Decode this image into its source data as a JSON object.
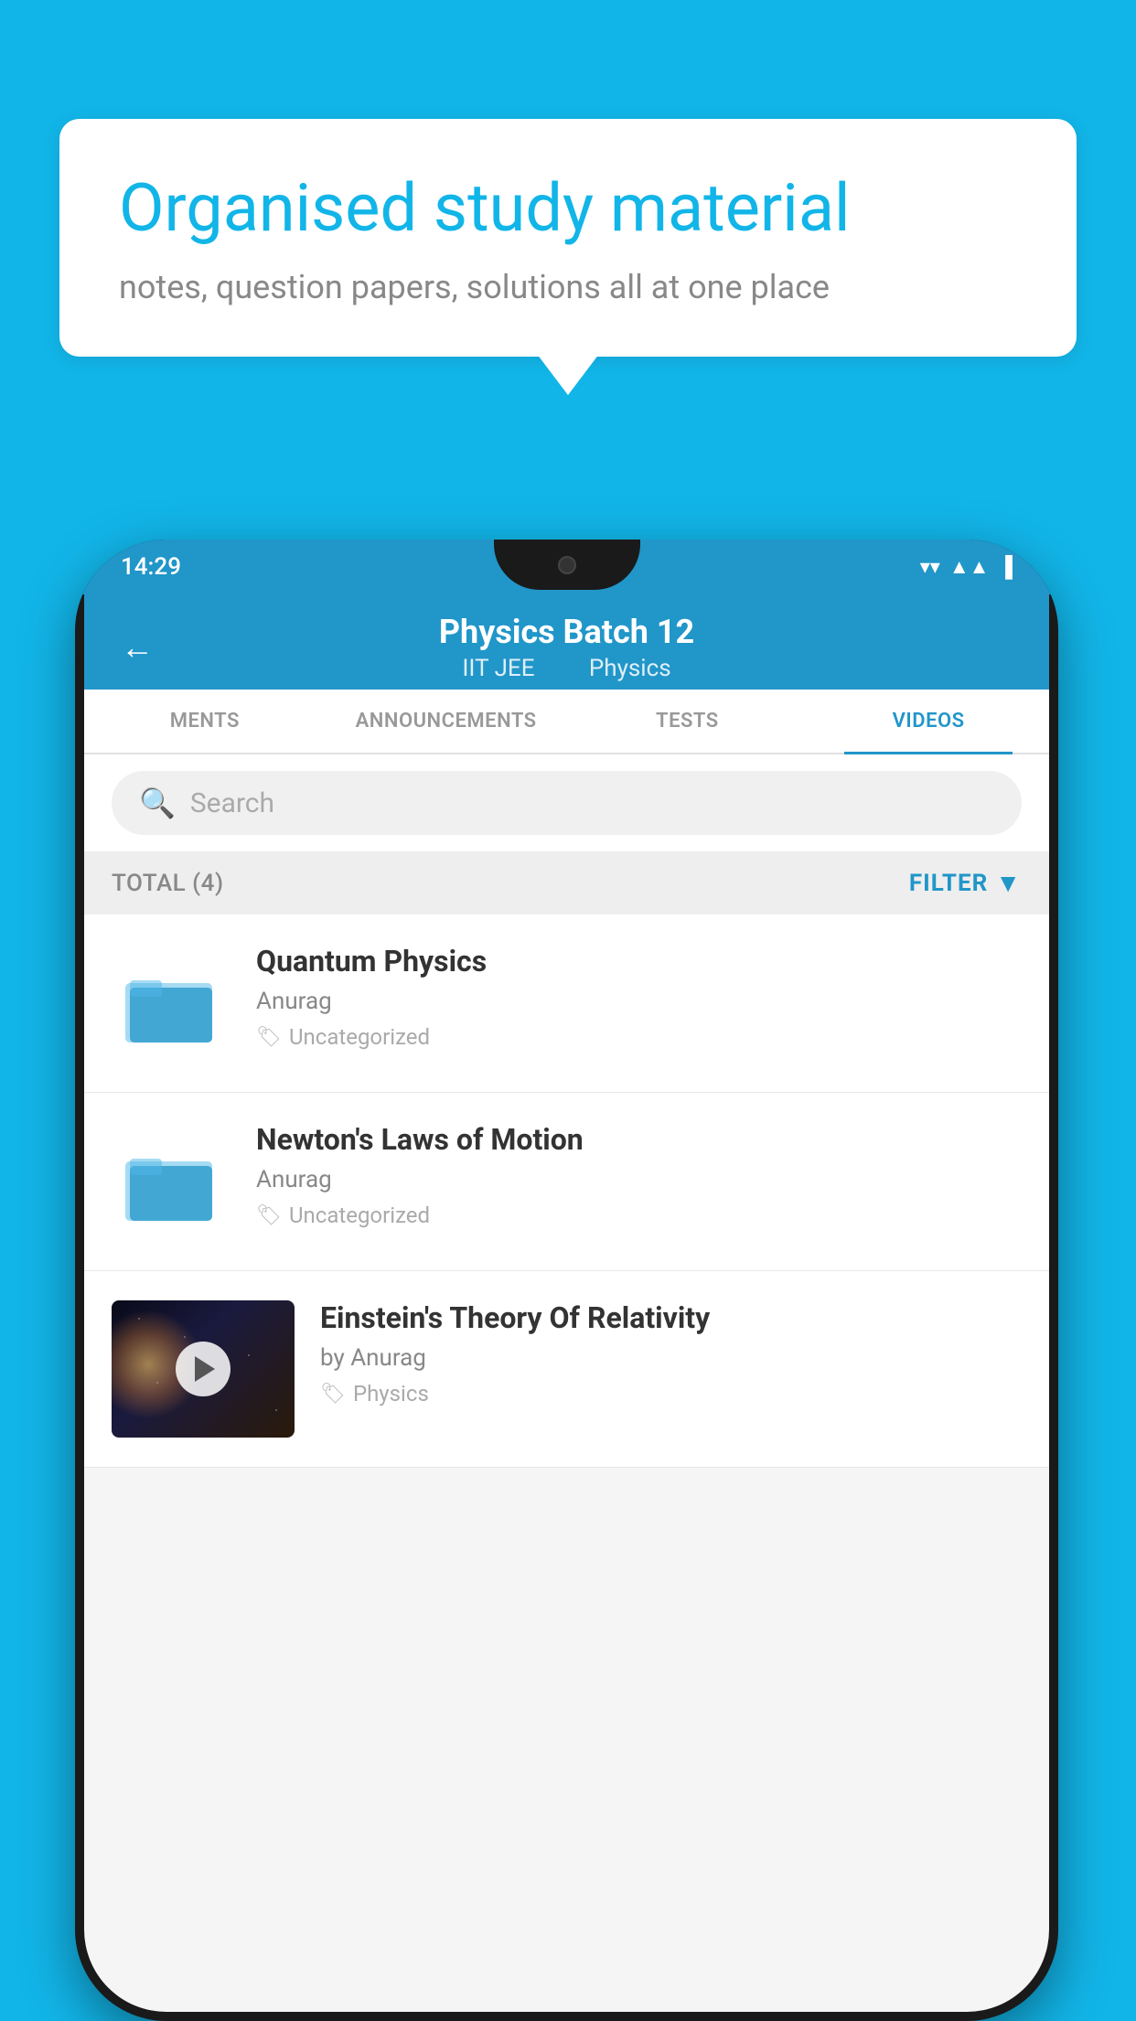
{
  "background_color": "#12b5e8",
  "speech_bubble": {
    "headline": "Organised study material",
    "subtext": "notes, question papers, solutions all at one place"
  },
  "phone": {
    "status_bar": {
      "time": "14:29",
      "icons": [
        "wifi",
        "signal",
        "battery"
      ]
    },
    "header": {
      "title": "Physics Batch 12",
      "subtitle_part1": "IIT JEE",
      "subtitle_part2": "Physics",
      "back_label": "←"
    },
    "tabs": [
      {
        "label": "MENTS",
        "active": false
      },
      {
        "label": "ANNOUNCEMENTS",
        "active": false
      },
      {
        "label": "TESTS",
        "active": false
      },
      {
        "label": "VIDEOS",
        "active": true
      }
    ],
    "search": {
      "placeholder": "Search"
    },
    "filter_bar": {
      "total_label": "TOTAL (4)",
      "filter_label": "FILTER"
    },
    "videos": [
      {
        "id": 1,
        "title": "Quantum Physics",
        "author": "Anurag",
        "tag": "Uncategorized",
        "has_thumbnail": false
      },
      {
        "id": 2,
        "title": "Newton's Laws of Motion",
        "author": "Anurag",
        "tag": "Uncategorized",
        "has_thumbnail": false
      },
      {
        "id": 3,
        "title": "Einstein's Theory Of Relativity",
        "author": "by Anurag",
        "tag": "Physics",
        "has_thumbnail": true
      }
    ]
  }
}
